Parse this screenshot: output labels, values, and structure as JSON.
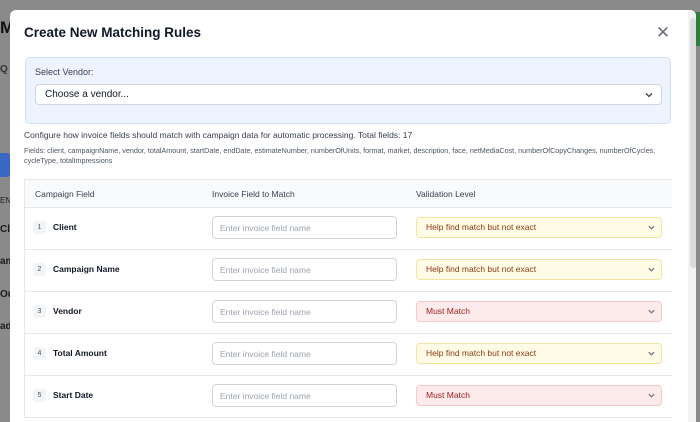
{
  "background": {
    "title_fragment": "M",
    "search_fragment": "Q",
    "side_fragments": [
      "ENI",
      "Clie",
      "am",
      "Out",
      "ada"
    ]
  },
  "modal": {
    "title": "Create New Matching Rules",
    "close_icon": "close-icon"
  },
  "vendor": {
    "label": "Select Vendor:",
    "selected": "Choose a vendor..."
  },
  "description": "Configure how invoice fields should match with campaign data for automatic processing. Total fields: 17",
  "fields_list": "Fields: client, campaignName, vendor, totalAmount, startDate, endDate, estimateNumber, numberOfUnits, format, market, description, face, netMediaCost, numberOfCopyChanges, numberOfCycles, cycleType, totalImpressions",
  "table": {
    "headers": {
      "campaign_field": "Campaign Field",
      "invoice_field": "Invoice Field to Match",
      "validation": "Validation Level"
    },
    "input_placeholder": "Enter invoice field name",
    "rows": [
      {
        "index": "1",
        "field": "Client",
        "validation": "Help find match but not exact",
        "level": "help"
      },
      {
        "index": "2",
        "field": "Campaign Name",
        "validation": "Help find match but not exact",
        "level": "help"
      },
      {
        "index": "3",
        "field": "Vendor",
        "validation": "Must Match",
        "level": "must"
      },
      {
        "index": "4",
        "field": "Total Amount",
        "validation": "Help find match but not exact",
        "level": "help"
      },
      {
        "index": "5",
        "field": "Start Date",
        "validation": "Must Match",
        "level": "must"
      }
    ]
  },
  "colors": {
    "help_bg": "#fffbe6",
    "must_bg": "#fdeaea",
    "vendor_bg": "#eef4ff"
  }
}
